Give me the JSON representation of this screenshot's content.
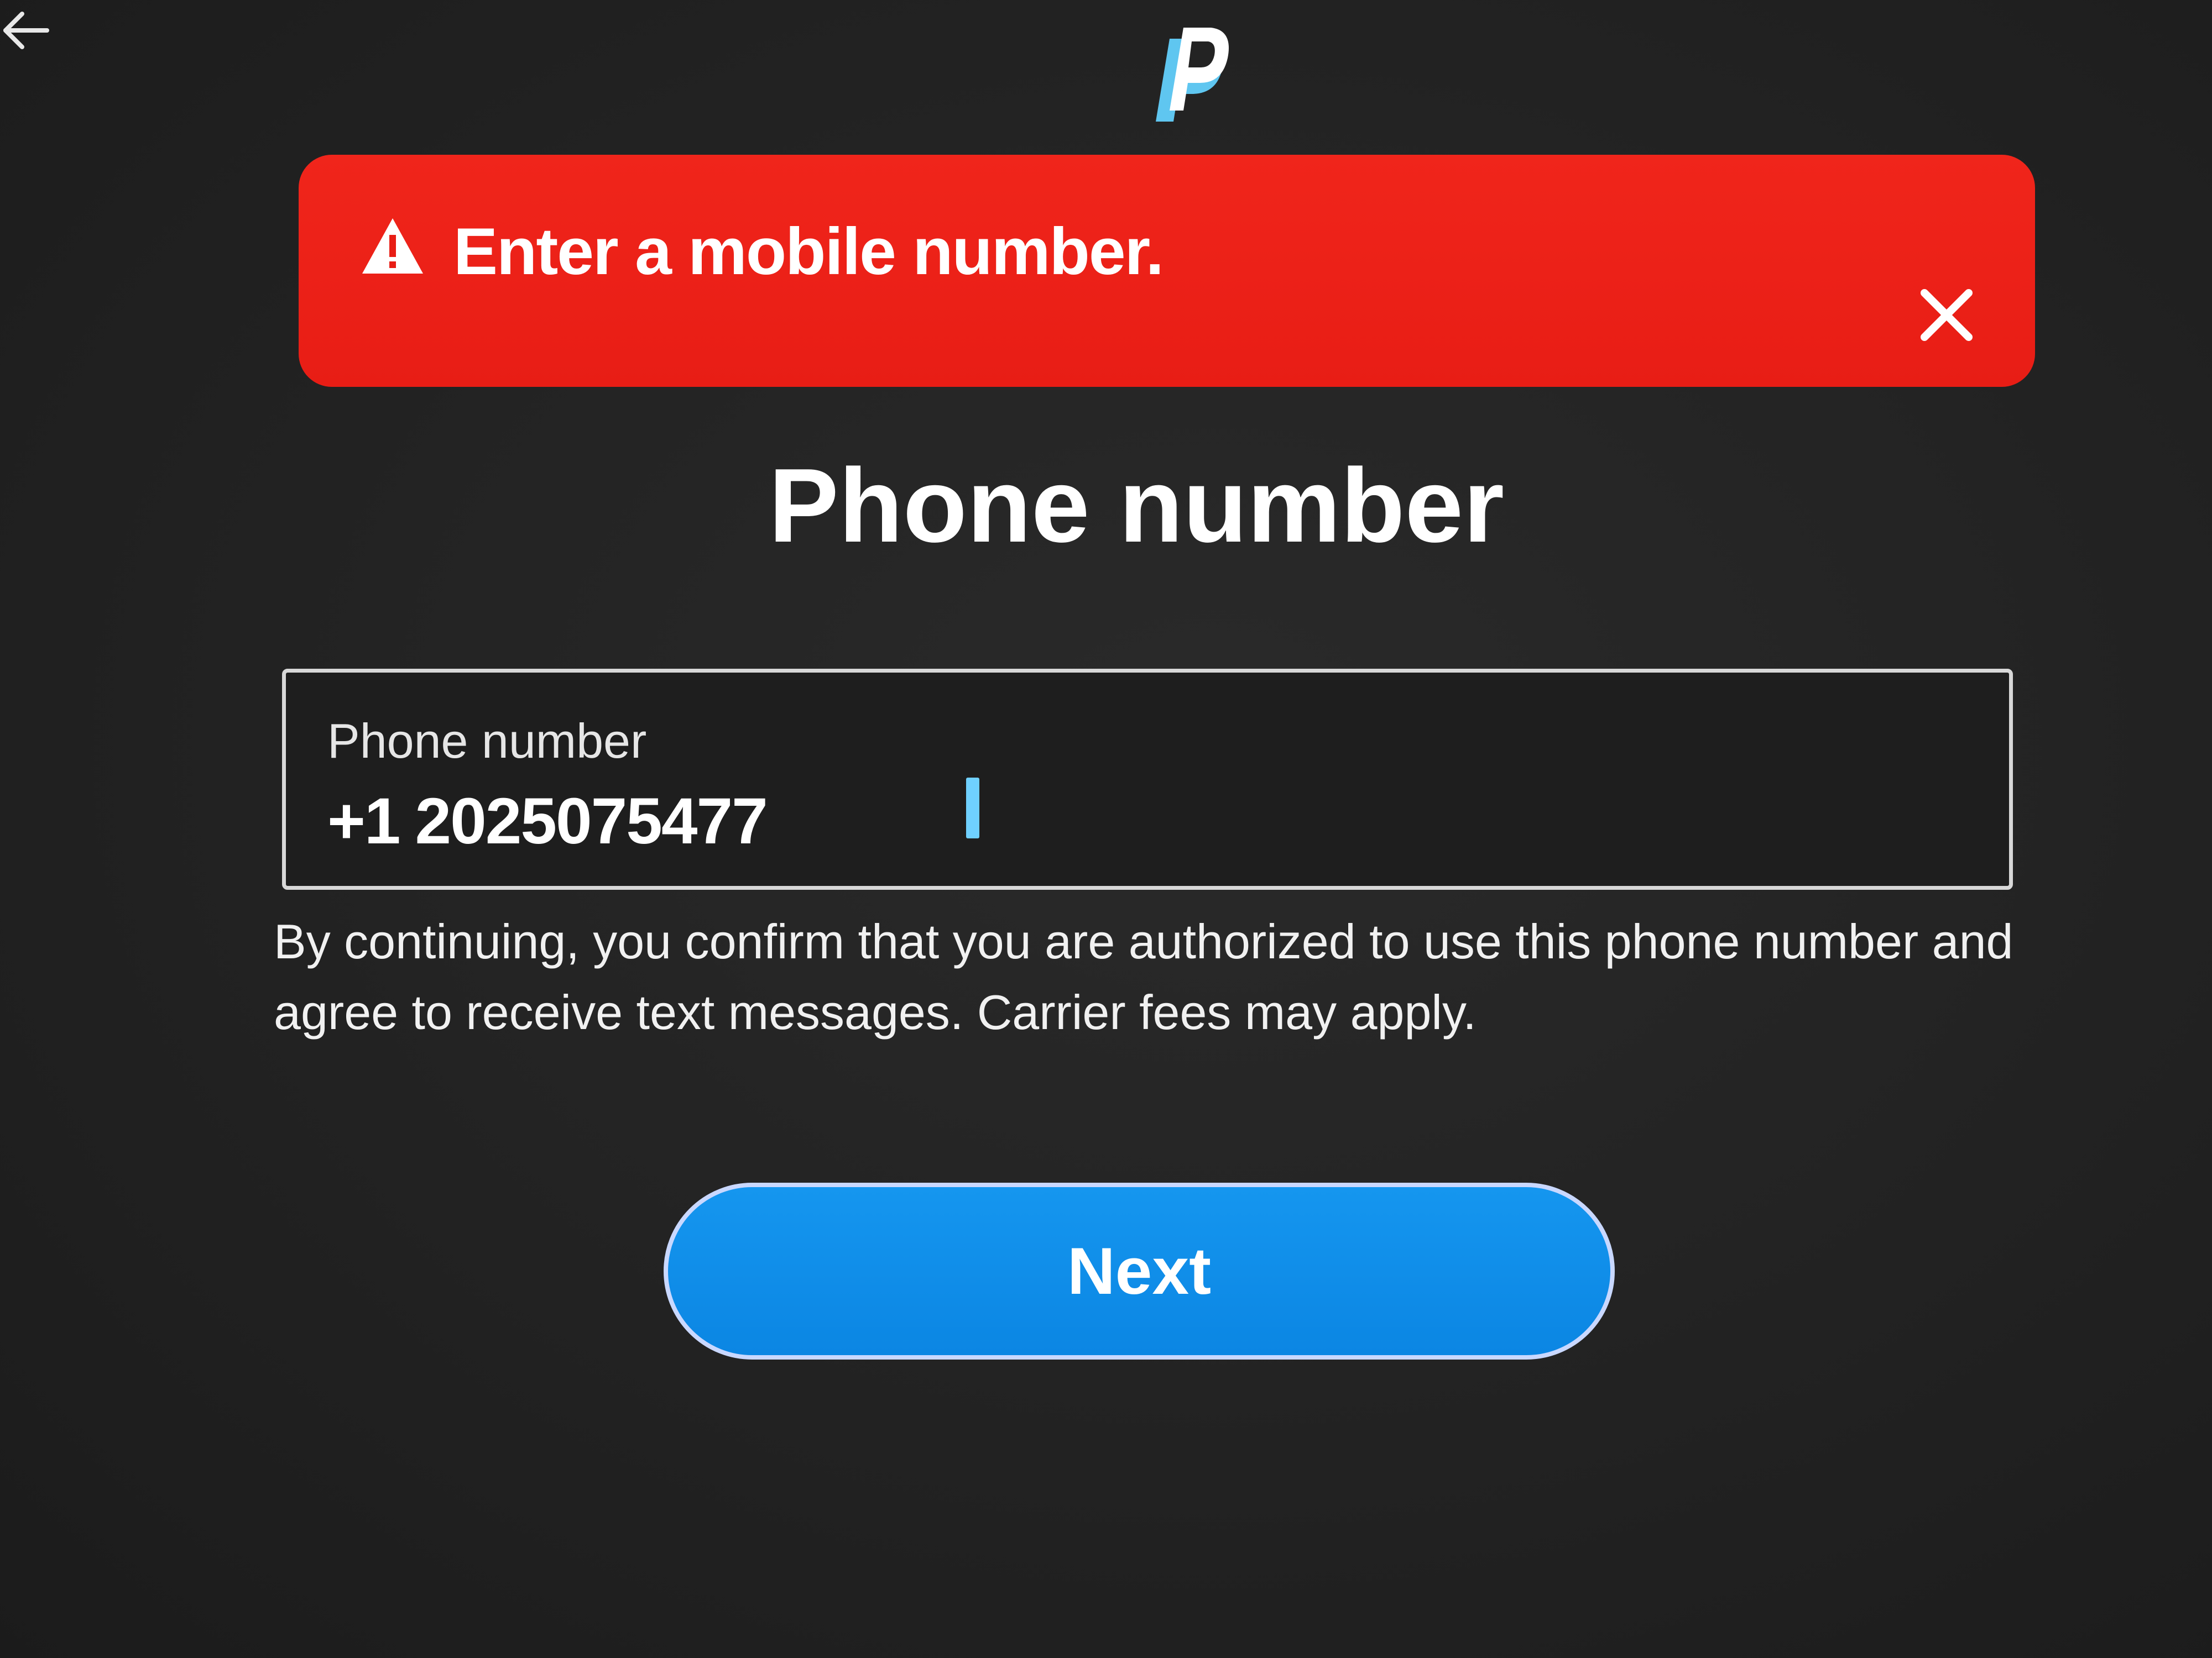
{
  "header": {
    "back_icon": "back-arrow-icon",
    "logo_icon": "paypal-logo-icon"
  },
  "alert": {
    "icon": "warning-triangle-icon",
    "message": "Enter a mobile number.",
    "close_icon": "close-icon",
    "color": "#e81d15"
  },
  "main": {
    "title": "Phone number"
  },
  "phone_field": {
    "label": "Phone number",
    "country_code": "+1",
    "value": "2025075477"
  },
  "disclaimer": "By continuing, you confirm that you are authorized to use this phone number and agree to receive text messages. Carrier fees may apply.",
  "actions": {
    "next_label": "Next",
    "accent_color": "#0b86e3"
  }
}
